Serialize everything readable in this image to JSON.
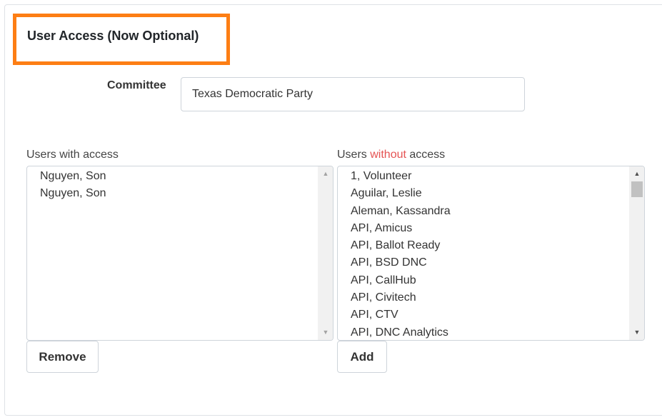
{
  "section": {
    "title": "User Access (Now Optional)",
    "highlight_color": "#fd7e14"
  },
  "committee": {
    "label": "Committee",
    "value": "Texas Democratic Party"
  },
  "users_with_access": {
    "label": "Users with access",
    "items": [
      "Nguyen, Son",
      "Nguyen, Son"
    ],
    "remove_button": "Remove"
  },
  "users_without_access": {
    "label_prefix": "Users ",
    "label_emphasis": "without",
    "label_suffix": " access",
    "emphasis_color": "#e55353",
    "items": [
      "1, Volunteer",
      "Aguilar, Leslie",
      "Aleman, Kassandra",
      "API, Amicus",
      "API, Ballot Ready",
      "API, BSD DNC",
      "API, CallHub",
      "API, Civitech",
      "API, CTV",
      "API, DNC Analytics"
    ],
    "add_button": "Add"
  },
  "icons": {
    "scroll_up": "▲",
    "scroll_down": "▼"
  }
}
